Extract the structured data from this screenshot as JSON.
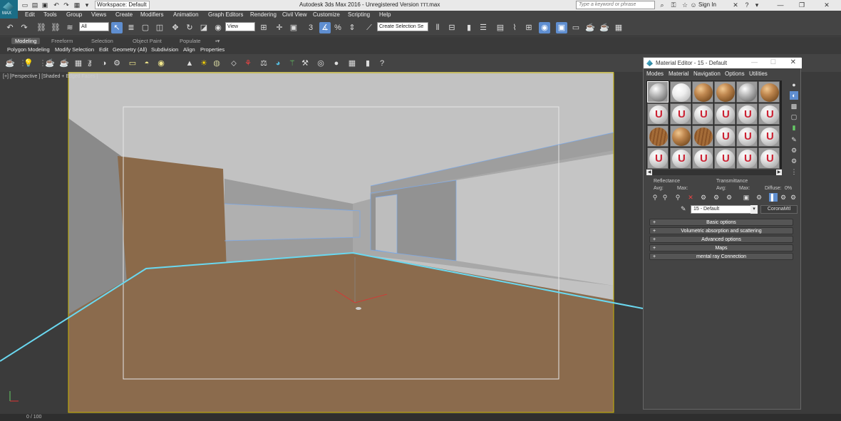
{
  "titlebar": {
    "app_title": "Autodesk 3ds Max 2016 - Unregistered Version    ттт.max",
    "workspace": "Workspace: Default",
    "search_placeholder": "Type a keyword or phrase",
    "sign_in": "Sign In",
    "logo_text": "MAX"
  },
  "menubar": {
    "items": [
      "Edit",
      "Tools",
      "Group",
      "Views",
      "Create",
      "Modifiers",
      "Animation",
      "Graph Editors",
      "Rendering",
      "Civil View",
      "Customize",
      "Scripting",
      "Help"
    ]
  },
  "main_toolbar": {
    "filter_value": "All",
    "view_value": "View",
    "selection_set_placeholder": "Create Selection Se"
  },
  "ribbon": {
    "tabs": [
      "Modeling",
      "Freeform",
      "Selection",
      "Object Paint",
      "Populate"
    ],
    "active_tab": "Modeling",
    "row": [
      "Polygon Modeling",
      "Modify Selection",
      "Edit",
      "Geometry (All)",
      "Subdivision",
      "Align",
      "Properties"
    ]
  },
  "viewport": {
    "label": "[+] [Perspective ] [Shaded + Edged Faces ]"
  },
  "status": {
    "timeline": "0 / 100"
  },
  "material_editor": {
    "title": "Material Editor - 15 - Default",
    "menu": [
      "Modes",
      "Material",
      "Navigation",
      "Options",
      "Utilities"
    ],
    "reflectance_label": "Reflectance",
    "transmittance_label": "Transmittance",
    "avg_label": "Avg:",
    "max_label": "Max:",
    "diffuse_label": "Diffuse:",
    "diffuse_value": "0%",
    "material_name": "15 - Default",
    "material_type": "CoronaMtl",
    "rollouts": [
      "Basic options",
      "Volumetric absorption and scattering",
      "Advanced options",
      "Maps",
      "mental ray Connection"
    ],
    "slot_letter": "U"
  }
}
